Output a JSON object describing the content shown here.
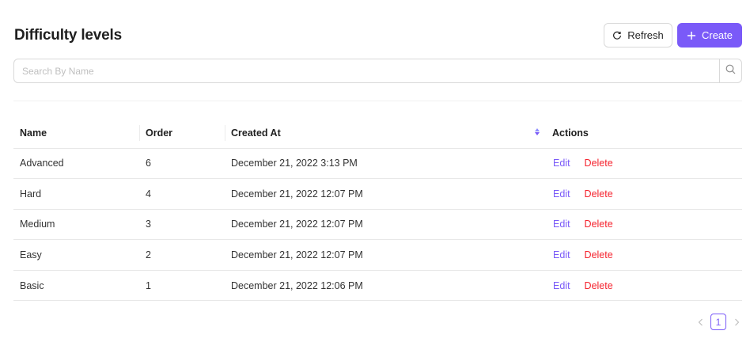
{
  "page": {
    "title": "Difficulty levels"
  },
  "toolbar": {
    "refresh_label": "Refresh",
    "create_label": "Create"
  },
  "search": {
    "placeholder": "Search By Name",
    "value": ""
  },
  "table": {
    "headers": {
      "name": "Name",
      "order": "Order",
      "created_at": "Created At",
      "actions": "Actions"
    },
    "rows": [
      {
        "name": "Advanced",
        "order": "6",
        "created_at": "December 21, 2022 3:13 PM",
        "edit": "Edit",
        "delete": "Delete"
      },
      {
        "name": "Hard",
        "order": "4",
        "created_at": "December 21, 2022 12:07 PM",
        "edit": "Edit",
        "delete": "Delete"
      },
      {
        "name": "Medium",
        "order": "3",
        "created_at": "December 21, 2022 12:07 PM",
        "edit": "Edit",
        "delete": "Delete"
      },
      {
        "name": "Easy",
        "order": "2",
        "created_at": "December 21, 2022 12:07 PM",
        "edit": "Edit",
        "delete": "Delete"
      },
      {
        "name": "Basic",
        "order": "1",
        "created_at": "December 21, 2022 12:06 PM",
        "edit": "Edit",
        "delete": "Delete"
      }
    ]
  },
  "pagination": {
    "current": "1",
    "prev_icon": "chevron-left-icon",
    "next_icon": "chevron-right-icon"
  },
  "colors": {
    "accent": "#7a5af8",
    "danger": "#f5222d"
  }
}
